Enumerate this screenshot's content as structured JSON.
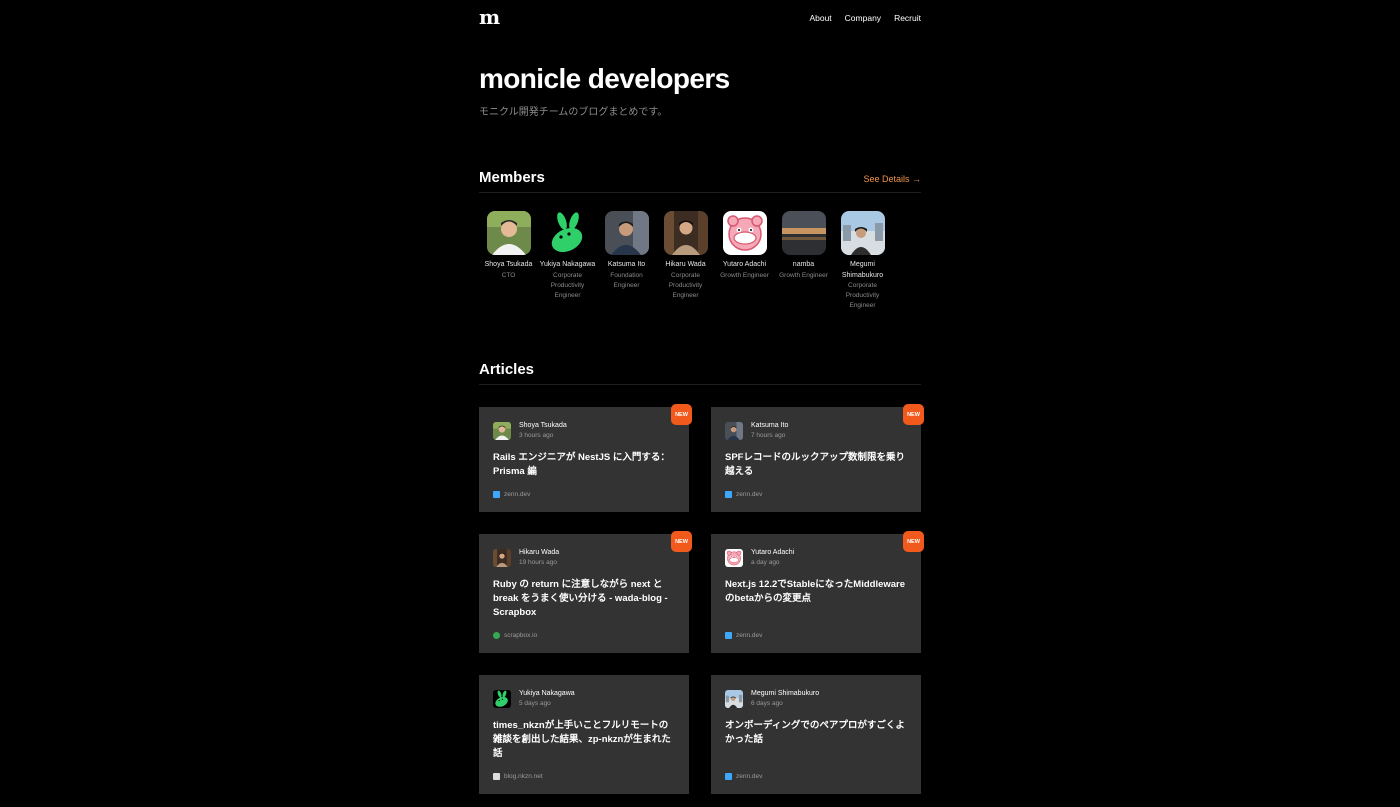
{
  "header": {
    "logo": "m",
    "nav": [
      {
        "label": "About"
      },
      {
        "label": "Company"
      },
      {
        "label": "Recruit"
      }
    ]
  },
  "hero": {
    "title": "monicle developers",
    "subtitle": "モニクル開発チームのブログまとめです。"
  },
  "members_section": {
    "title": "Members",
    "see_details": "See Details →",
    "members": [
      {
        "name": "Shoya Tsukada",
        "role": "CTO",
        "avatar": "person-photo"
      },
      {
        "name": "Yukiya Nakagawa",
        "role": "Corporate Productivity Engineer",
        "avatar": "green-rabbit-icon"
      },
      {
        "name": "Katsuma Ito",
        "role": "Foundation Engineer",
        "avatar": "person-photo"
      },
      {
        "name": "Hikaru Wada",
        "role": "Corporate Productivity Engineer",
        "avatar": "person-photo"
      },
      {
        "name": "Yutaro Adachi",
        "role": "Growth Engineer",
        "avatar": "pink-character-icon"
      },
      {
        "name": "namba",
        "role": "Growth Engineer",
        "avatar": "sunset-photo"
      },
      {
        "name": "Megumi Shimabukuro",
        "role": "Corporate Productivity Engineer",
        "avatar": "person-photo"
      }
    ]
  },
  "articles_section": {
    "title": "Articles",
    "articles": [
      {
        "author": "Shoya Tsukada",
        "time": "3 hours ago",
        "title": "Rails エンジニアが NestJS に入門する：Prisma 編",
        "source": "zenn.dev",
        "badge": "NEW"
      },
      {
        "author": "Katsuma Ito",
        "time": "7 hours ago",
        "title": "SPFレコードのルックアップ数制限を乗り越える",
        "source": "zenn.dev",
        "badge": "NEW"
      },
      {
        "author": "Hikaru Wada",
        "time": "19 hours ago",
        "title": "Ruby の return に注意しながら next と break をうまく使い分ける - wada-blog - Scrapbox",
        "source": "scrapbox.io",
        "badge": "NEW"
      },
      {
        "author": "Yutaro Adachi",
        "time": "a day ago",
        "title": "Next.js 12.2でStableになったMiddlewareのbetaからの変更点",
        "source": "zenn.dev",
        "badge": "NEW"
      },
      {
        "author": "Yukiya Nakagawa",
        "time": "5 days ago",
        "title": "times_nkznが上手いことフルリモートの雑談を創出した結果、zp-nkznが生まれた話",
        "source": "blog.nkzn.net",
        "badge": ""
      },
      {
        "author": "Megumi Shimabukuro",
        "time": "6 days ago",
        "title": "オンボーディングでのペアプロがすごくよかった話",
        "source": "zenn.dev",
        "badge": ""
      }
    ]
  }
}
